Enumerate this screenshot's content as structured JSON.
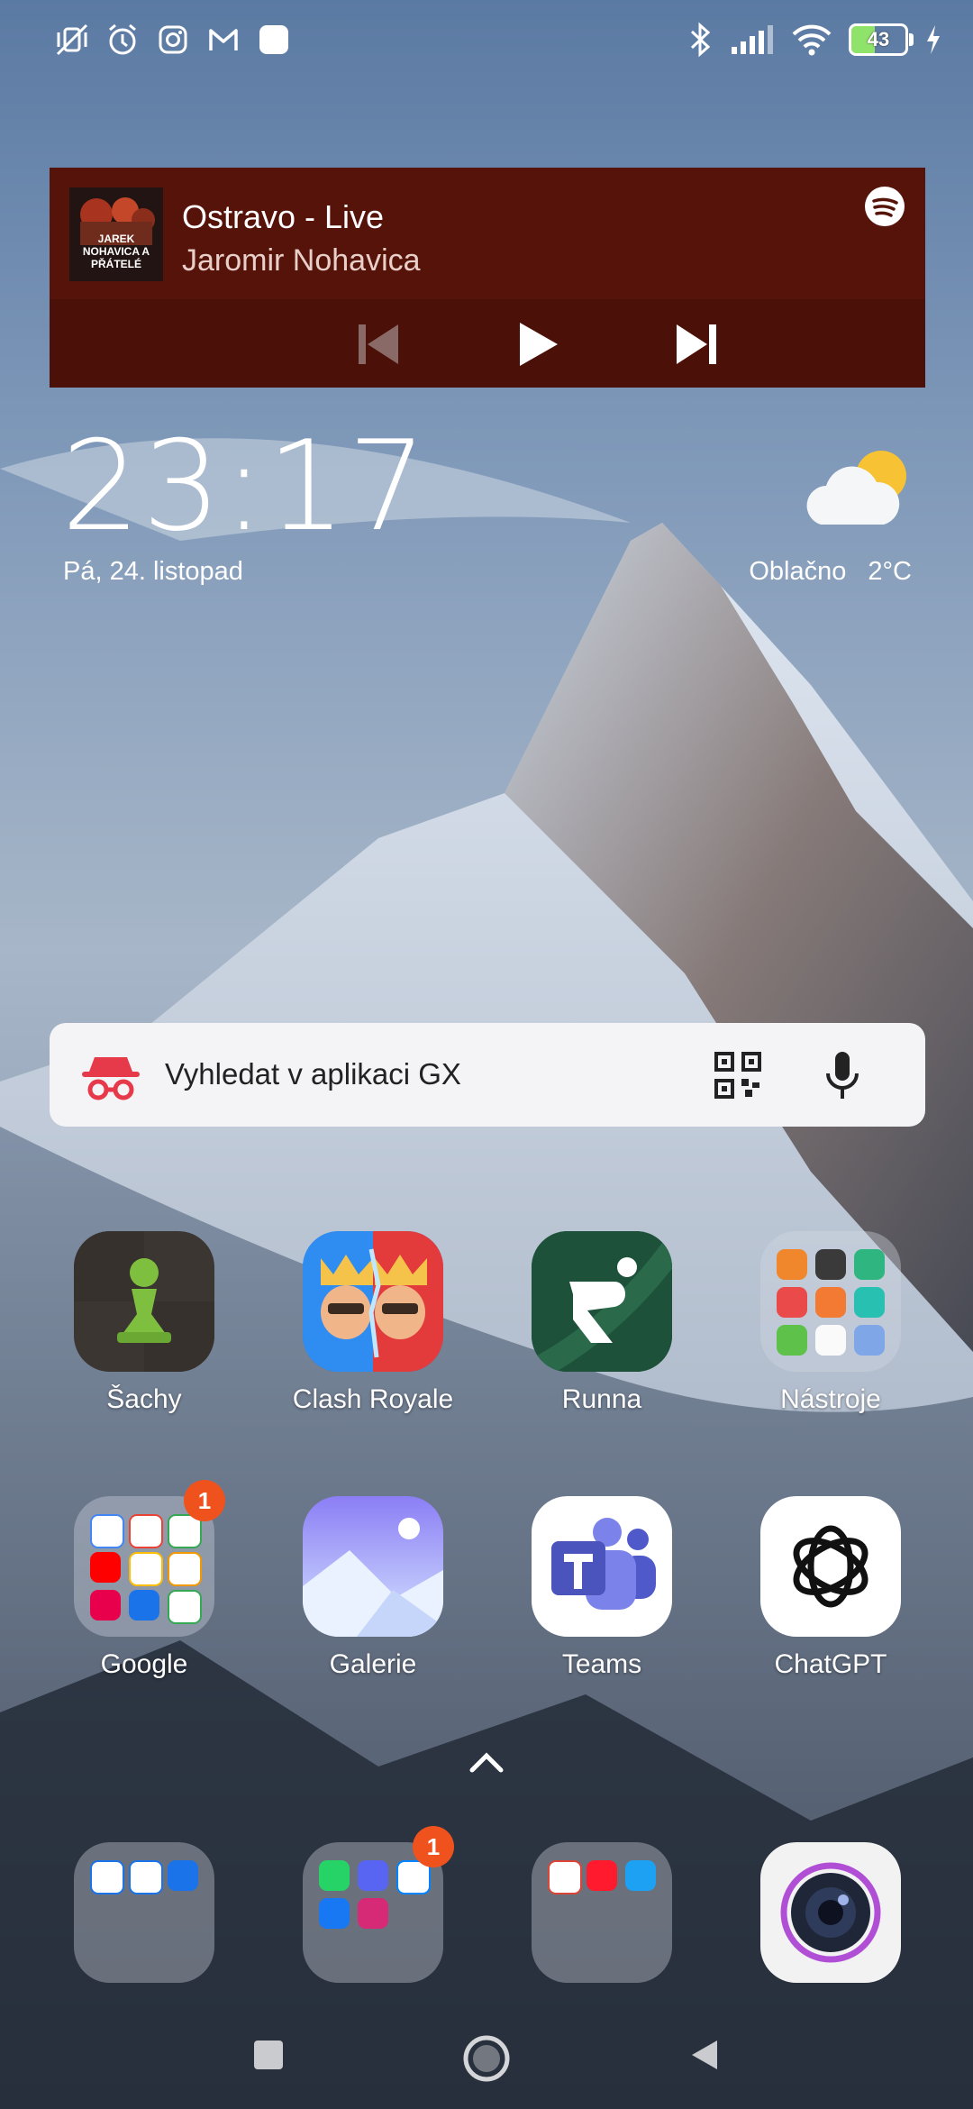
{
  "status_bar": {
    "left_icons": [
      "mute-vibrate-icon",
      "alarm-icon",
      "instagram-icon",
      "gmail-icon",
      "app-square-icon"
    ],
    "right_icons": [
      "bluetooth-icon",
      "signal-icon",
      "wifi-icon",
      "battery-icon",
      "charging-icon"
    ],
    "battery": "43"
  },
  "media_widget": {
    "title": "Ostravo - Live",
    "artist": "Jaromir Nohavica",
    "album_text": "JAREK NOHAVICA A PŘÁTELÉ",
    "colors": {
      "background": "#561309",
      "controls": "#4b1007"
    }
  },
  "clock": {
    "time": "23:17",
    "date": "Pá, 24. listopad",
    "weather_condition": "Oblačno",
    "temperature": "2°C"
  },
  "search": {
    "placeholder": "Vyhledat v aplikaci GX"
  },
  "apps_row1": [
    {
      "label": "Šachy",
      "icon": "chess-icon"
    },
    {
      "label": "Clash Royale",
      "icon": "clash-royale-icon"
    },
    {
      "label": "Runna",
      "icon": "runna-icon"
    },
    {
      "label": "Nástroje",
      "icon": "tools-folder-icon"
    }
  ],
  "apps_row2": [
    {
      "label": "Google",
      "icon": "google-folder-icon",
      "badge": "1"
    },
    {
      "label": "Galerie",
      "icon": "gallery-icon"
    },
    {
      "label": "Teams",
      "icon": "teams-icon"
    },
    {
      "label": "ChatGPT",
      "icon": "chatgpt-icon"
    }
  ],
  "dock": [
    {
      "icon": "phone-folder-icon"
    },
    {
      "icon": "social-folder-icon",
      "badge": "1"
    },
    {
      "icon": "browsers-folder-icon"
    },
    {
      "icon": "camera-icon"
    }
  ],
  "nav_bar": [
    "recents-button",
    "home-button",
    "back-button"
  ]
}
